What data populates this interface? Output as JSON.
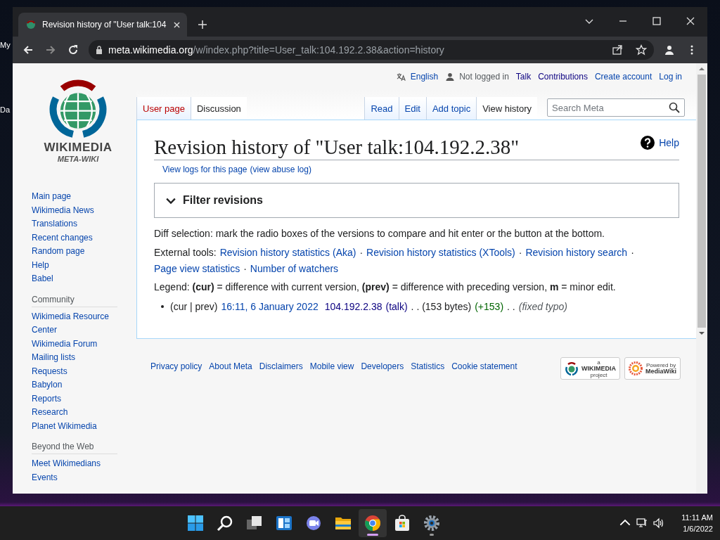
{
  "desktop": {
    "labels": [
      "My",
      "Da"
    ]
  },
  "browser": {
    "tab": {
      "title": "Revision history of \"User talk:104",
      "selected": true
    },
    "url_host": "meta.wikimedia.org",
    "url_path": "/w/index.php?title=User_talk:104.192.2.38&action=history"
  },
  "site": {
    "logo_name": "WIKIMEDIA",
    "logo_sub": "META-WIKI"
  },
  "personal": {
    "language": "English",
    "status": "Not logged in",
    "links": [
      "Talk",
      "Contributions",
      "Create account",
      "Log in"
    ]
  },
  "tabs_left": [
    {
      "label": "User page",
      "selected": false
    },
    {
      "label": "Discussion",
      "selected": true
    }
  ],
  "tabs_right": [
    {
      "label": "Read",
      "selected": false
    },
    {
      "label": "Edit",
      "selected": false
    },
    {
      "label": "Add topic",
      "selected": false
    },
    {
      "label": "View history",
      "selected": true
    }
  ],
  "search": {
    "placeholder": "Search Meta"
  },
  "sidebar": {
    "main": [
      "Main page",
      "Wikimedia News",
      "Translations",
      "Recent changes",
      "Random page",
      "Help",
      "Babel"
    ],
    "sections": [
      {
        "heading": "Community",
        "items": [
          "Wikimedia Resource Center",
          "Wikimedia Forum",
          "Mailing lists",
          "Requests",
          "Babylon",
          "Reports",
          "Research",
          "Planet Wikimedia"
        ]
      },
      {
        "heading": "Beyond the Web",
        "items": [
          "Meet Wikimedians",
          "Events"
        ]
      }
    ]
  },
  "page": {
    "title": "Revision history of \"User talk:104.192.2.38\"",
    "help": "Help",
    "logs_link": "View logs for this page",
    "abuse_link": "(view abuse log)",
    "filter": {
      "label": "Filter revisions",
      "expanded": false
    },
    "diff_note": "Diff selection: mark the radio boxes of the versions to compare and hit enter or the button at the bottom.",
    "external_tools": {
      "label": "External tools:",
      "separator": "·",
      "links": [
        "Revision history statistics (Aka)",
        "Revision history statistics (XTools)",
        "Revision history search",
        "Page view statistics",
        "Number of watchers"
      ]
    },
    "legend": "Legend: **(cur)** = difference with current version, **(prev)** = difference with preceding version, **m** = minor edit.",
    "revisions": [
      {
        "cur_prev": "(cur | prev)",
        "date": "16:11, 6 January 2022",
        "user": "104.192.2.38",
        "talk": "(talk)",
        "size": ". . (153 bytes)",
        "change": "(+153)",
        "sep": ". .",
        "summary": "(fixed typo)"
      }
    ]
  },
  "footer": {
    "links": [
      "Privacy policy",
      "About Meta",
      "Disclaimers",
      "Mobile view",
      "Developers",
      "Statistics",
      "Cookie statement"
    ],
    "badges": [
      {
        "kind": "wikimedia",
        "small": "a",
        "big": "WIKIMEDIA",
        "sub": "project"
      },
      {
        "kind": "mediawiki",
        "small": "Powered by",
        "big": "MediaWiki"
      }
    ]
  },
  "taskbar": {
    "apps": [
      {
        "kind": "start",
        "active": false,
        "running": false
      },
      {
        "kind": "search",
        "active": false,
        "running": false
      },
      {
        "kind": "taskview",
        "active": false,
        "running": false
      },
      {
        "kind": "widgets",
        "active": false,
        "running": false
      },
      {
        "kind": "chat",
        "active": false,
        "running": false
      },
      {
        "kind": "folder",
        "active": false,
        "running": false
      },
      {
        "kind": "chrome",
        "active": true,
        "running": true
      },
      {
        "kind": "store",
        "active": false,
        "running": false
      },
      {
        "kind": "settings",
        "active": false,
        "running": true
      }
    ],
    "time": "11:11 AM",
    "date": "1/6/2022"
  }
}
